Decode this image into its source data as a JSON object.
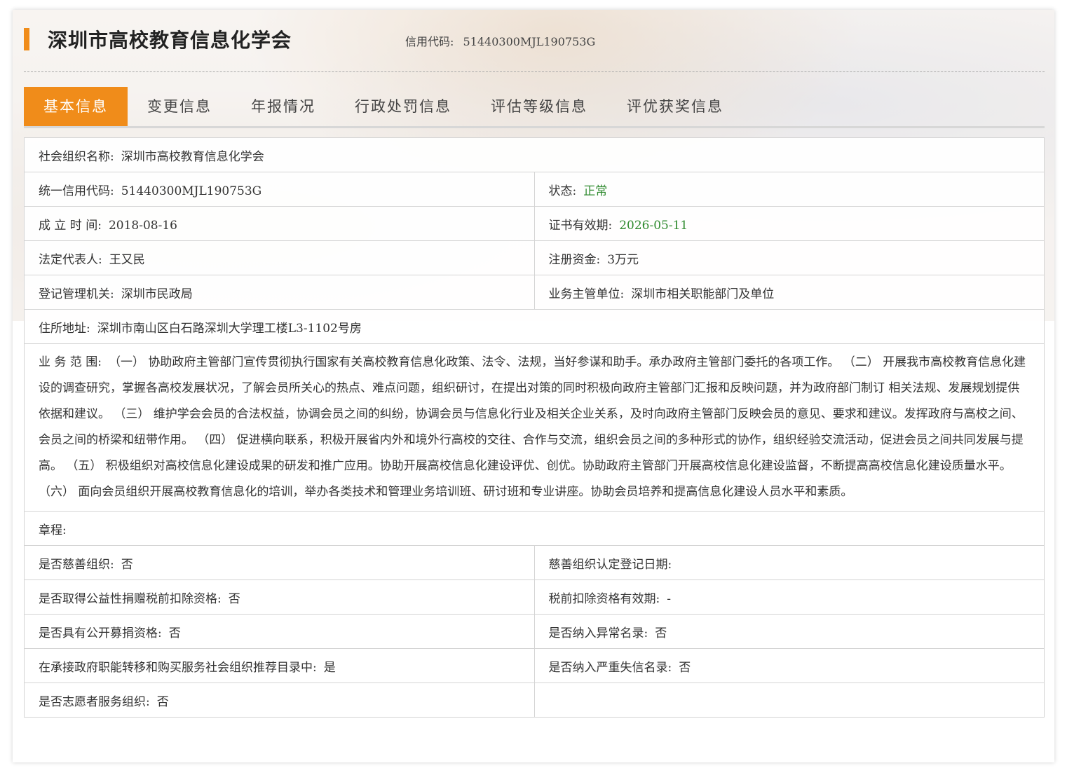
{
  "header": {
    "org_title": "深圳市高校教育信息化学会",
    "credit_label": "信用代码:",
    "credit_value": "51440300MJL190753G"
  },
  "tabs": [
    {
      "label": "基本信息",
      "active": true
    },
    {
      "label": "变更信息",
      "active": false
    },
    {
      "label": "年报情况",
      "active": false
    },
    {
      "label": "行政处罚信息",
      "active": false
    },
    {
      "label": "评估等级信息",
      "active": false
    },
    {
      "label": "评优获奖信息",
      "active": false
    }
  ],
  "info": {
    "name_label": "社会组织名称:",
    "name_value": "深圳市高校教育信息化学会",
    "uscc_label": "统一信用代码:",
    "uscc_value": "51440300MJL190753G",
    "status_label": "状态:",
    "status_value": "正常",
    "founded_label": "成 立 时 间:",
    "founded_value": "2018-08-16",
    "cert_label": "证书有效期:",
    "cert_value": "2026-05-11",
    "legal_label": "法定代表人:",
    "legal_value": "王又民",
    "capital_label": "注册资金:",
    "capital_value": "3万元",
    "authority_label": "登记管理机关:",
    "authority_value": "深圳市民政局",
    "supervisor_label": "业务主管单位:",
    "supervisor_value": "深圳市相关职能部门及单位",
    "address_label": "住所地址:",
    "address_value": "深圳市南山区白石路深圳大学理工楼L3-1102号房",
    "scope_label": "业 务 范 围:",
    "scope_value": "（一） 协助政府主管部门宣传贯彻执行国家有关高校教育信息化政策、法令、法规，当好参谋和助手。承办政府主管部门委托的各项工作。 （二） 开展我市高校教育信息化建设的调查研究，掌握各高校发展状况，了解会员所关心的热点、难点问题，组织研讨，在提出对策的同时积极向政府主管部门汇报和反映问题，并为政府部门制订 相关法规、发展规划提供依据和建议。 （三） 维护学会会员的合法权益，协调会员之间的纠纷，协调会员与信息化行业及相关企业关系，及时向政府主管部门反映会员的意见、要求和建议。发挥政府与高校之间、会员之间的桥梁和纽带作用。 （四） 促进横向联系，积极开展省内外和境外行高校的交往、合作与交流，组织会员之间的多种形式的协作，组织经验交流活动，促进会员之间共同发展与提高。 （五） 积极组织对高校信息化建设成果的研发和推广应用。协助开展高校信息化建设评优、创优。协助政府主管部门开展高校信息化建设监督，不断提高高校信息化建设质量水平。 （六） 面向会员组织开展高校教育信息化的培训，举办各类技术和管理业务培训班、研讨班和专业讲座。协助会员培养和提高信息化建设人员水平和素质。",
    "charter_label": "章程:",
    "charity_label": "是否慈善组织:",
    "charity_value": "否",
    "charity_date_label": "慈善组织认定登记日期:",
    "charity_date_value": "",
    "tax_label": "是否取得公益性捐赠税前扣除资格:",
    "tax_value": "否",
    "tax_valid_label": "税前扣除资格有效期:",
    "tax_valid_value": "-",
    "fundraise_label": "是否具有公开募捐资格:",
    "fundraise_value": "否",
    "abnormal_label": "是否纳入异常名录:",
    "abnormal_value": "否",
    "recommend_label": "在承接政府职能转移和购买服务社会组织推荐目录中:",
    "recommend_value": "是",
    "dishonest_label": "是否纳入严重失信名录:",
    "dishonest_value": "否",
    "volunteer_label": "是否志愿者服务组织:",
    "volunteer_value": "否"
  },
  "colors": {
    "accent": "#f08c1a",
    "status_green": "#2e8a2e",
    "border": "#d4d4d4"
  }
}
